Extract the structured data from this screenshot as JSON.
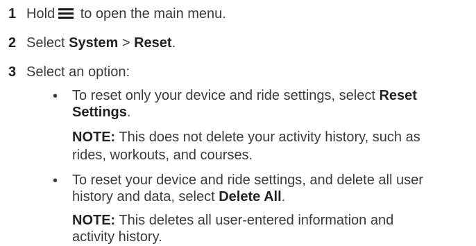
{
  "steps": [
    {
      "number": "1",
      "text_before": "Hold",
      "text_after": " to open the main menu."
    },
    {
      "number": "2",
      "text_before": "Select ",
      "bold1": "System",
      "sep": " > ",
      "bold2": "Reset",
      "end": "."
    },
    {
      "number": "3",
      "text": "Select an option:"
    }
  ],
  "options": [
    {
      "bullet": "•",
      "line1": "To reset only your device and ride settings, select ",
      "line1_bold": "Reset",
      "line2_bold": "Settings",
      "line2_end": ".",
      "note_label": "NOTE:",
      "note_line1": " This does not delete your activity history, such as",
      "note_line2": "rides, workouts, and courses."
    },
    {
      "bullet": "•",
      "line1": "To reset your device and ride settings, and delete all user",
      "line2": "history and data, select ",
      "line2_bold": "Delete All",
      "line2_end": ".",
      "note_label": "NOTE:",
      "note_line1": " This deletes all user-entered information and",
      "note_line2": "activity history."
    }
  ],
  "icons": {
    "menu": "menu-icon"
  }
}
